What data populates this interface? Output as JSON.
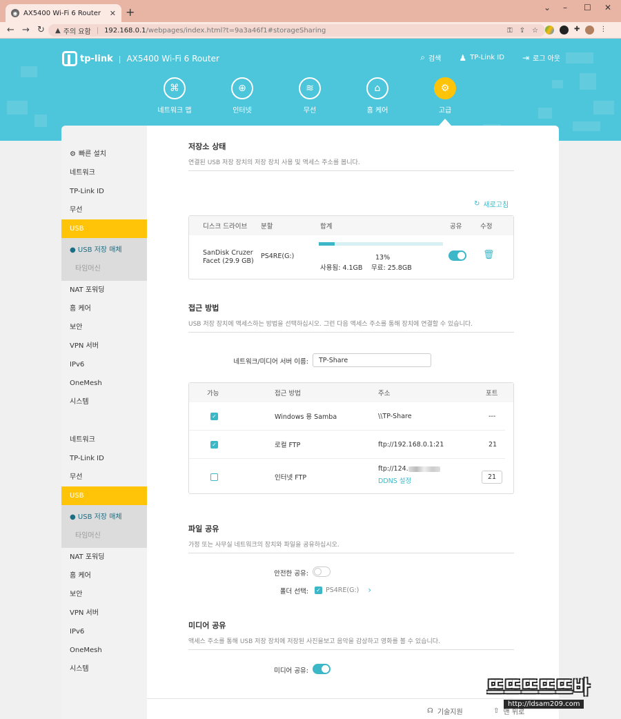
{
  "browser": {
    "tab_title": "AX5400 Wi-Fi 6 Router",
    "new_tab": "+",
    "minimize": "–",
    "maximize": "☐",
    "close": "✕",
    "security_warning": "주의 요함",
    "url_host": "192.168.0.1",
    "url_path": "/webpages/index.html?t=9a3a46f1#storageSharing"
  },
  "header": {
    "logo_text": "tp-link",
    "divider": "|",
    "product": "AX5400 Wi-Fi 6 Router",
    "search": "검색",
    "tplink_id": "TP-Link ID",
    "logout": "로그 아웃"
  },
  "nav": {
    "tabs": [
      {
        "label": "네트워크 맵",
        "icon": "network-map-icon"
      },
      {
        "label": "인터넷",
        "icon": "globe-icon"
      },
      {
        "label": "무선",
        "icon": "wifi-icon"
      },
      {
        "label": "홈 케어",
        "icon": "home-care-icon"
      },
      {
        "label": "고급",
        "icon": "gear-icon"
      }
    ]
  },
  "sidebar": {
    "quick_setup": "빠른 설치",
    "group1": [
      "네트워크",
      "TP-Link ID",
      "무선"
    ],
    "usb": "USB",
    "usb_storage": "● USB 저장 매체",
    "time_machine": "타임머신",
    "group2": [
      "NAT 포워딩",
      "홈 케어",
      "보안",
      "VPN 서버",
      "IPv6",
      "OneMesh",
      "시스템"
    ]
  },
  "storage": {
    "title": "저장소 상태",
    "desc": "연결된 USB 저장 장치의 저장 장치 사용 및 액세스 주소를 봅니다.",
    "refresh": "새로고침",
    "headers": {
      "drive": "디스크 드라이브",
      "partition": "분할",
      "total": "합계",
      "share": "공유",
      "edit": "수정"
    },
    "disk": {
      "name": "SanDisk Cruzer Facet (29.9 GB)",
      "partition": "PS4RE(G:)",
      "percent": "13%",
      "usage_fraction": 0.13,
      "used": "사용됨: 4.1GB",
      "free": "무료: 25.8GB"
    }
  },
  "access": {
    "title": "접근 방법",
    "desc": "USB 저장 장치에 액세스하는 방법을 선택하십시오. 그런 다음 액세스 주소를 통해 장치에 연결할 수 있습니다.",
    "server_name_label": "네트워크/미디어 서버 이름:",
    "server_name_value": "TP-Share",
    "headers": {
      "enabled": "가능",
      "method": "접근 방법",
      "address": "주소",
      "port": "포트"
    },
    "rows": [
      {
        "method": "Windows 용 Samba",
        "address": "\\\\TP-Share",
        "port": "---"
      },
      {
        "method": "로컬 FTP",
        "address": "ftp://192.168.0.1:21",
        "port": "21"
      },
      {
        "method": "인터넷 FTP",
        "address": "ftp://124.",
        "port": "21",
        "ddns": "DDNS 설정"
      }
    ]
  },
  "file_share": {
    "title": "파일 공유",
    "desc": "가정 또는 사무실 네트워크의 장치와 파일을 공유하십시오.",
    "secure_label": "안전한 공유:",
    "folder_label": "폴더 선택:",
    "folder_value": "PS4RE(G:)"
  },
  "media_share": {
    "title": "미디어 공유",
    "desc": "액세스 주소를 통해 USB 저장 장치에 저장된 사진을보고 음악을 감상하고 영화를 볼 수 있습니다.",
    "label": "미디어 공유:"
  },
  "footer": {
    "support": "기술지원",
    "top": "맨 위로"
  },
  "watermark": {
    "big": "뜨뜨뜨뜨뜨바",
    "small": "http://ldsam209.com"
  },
  "colors": {
    "accent": "#3bb7c8",
    "header_bg": "#4dc5da",
    "active": "#ffc408"
  }
}
